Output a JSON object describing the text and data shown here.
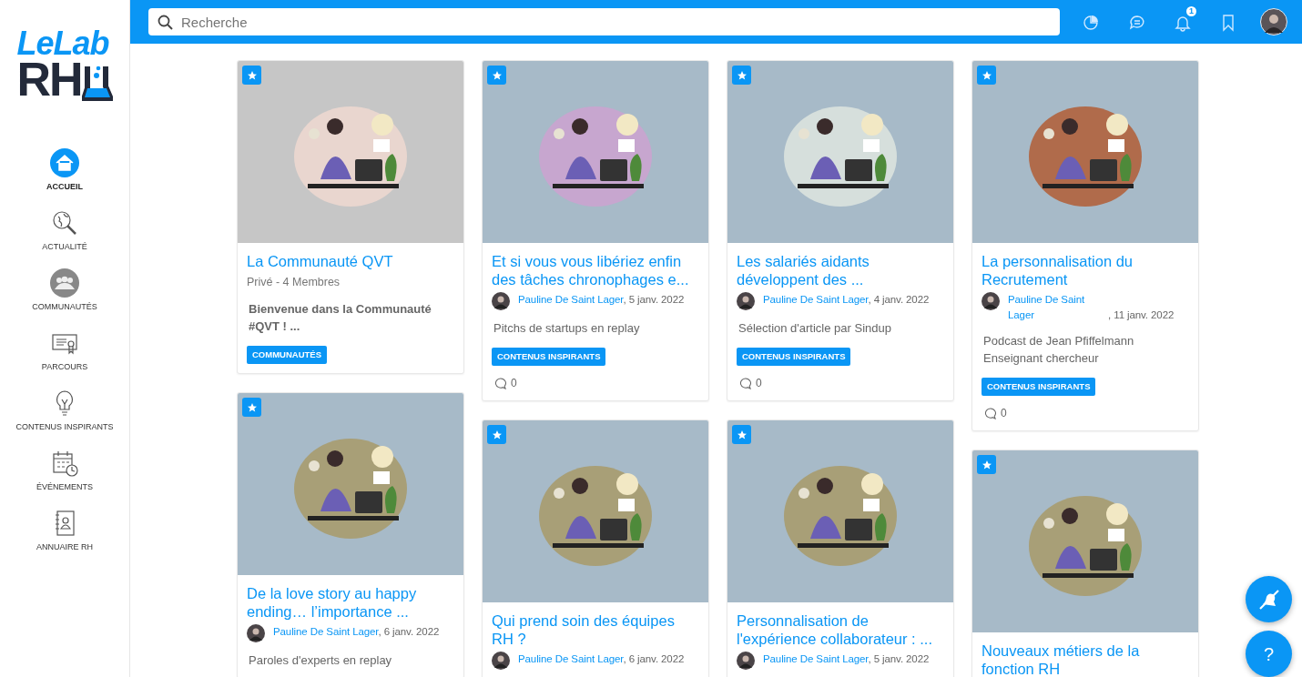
{
  "logo": {
    "top": "LeLab",
    "bottom": "RH"
  },
  "sidebar": {
    "items": [
      {
        "label": "ACCUEIL",
        "selected": true
      },
      {
        "label": "ACTUALITÉ",
        "selected": false
      },
      {
        "label": "COMMUNAUTÉS",
        "selected": false
      },
      {
        "label": "PARCOURS",
        "selected": false
      },
      {
        "label": "CONTENUS INSPIRANTS",
        "selected": false
      },
      {
        "label": "ÉVÉNEMENTS",
        "selected": false
      },
      {
        "label": "ANNUAIRE RH",
        "selected": false
      }
    ]
  },
  "topbar": {
    "search": {
      "placeholder": "Recherche"
    },
    "notifications": "1"
  },
  "columns": [
    [
      {
        "kind": "community",
        "title": "La Communauté QVT",
        "meta": "Privé - 4 Membres",
        "excerpt": "Bienvenue dans la Communauté #QVT ! ...",
        "tag": "COMMUNAUTÉS",
        "favorite": true
      },
      {
        "kind": "article",
        "title": "De la love story au happy ending… l’importance ...",
        "author": "Pauline De Saint Lager",
        "date": ", 6 janv. 2022",
        "excerpt": "Paroles d'experts en replay",
        "favorite": true
      }
    ],
    [
      {
        "kind": "article",
        "title": "Et si vous vous libériez enfin des tâches chronophages e...",
        "author": "Pauline De Saint Lager",
        "date": ", 5 janv. 2022",
        "excerpt": "Pitchs de startups en replay",
        "tag": "CONTENUS INSPIRANTS",
        "comments": "0",
        "favorite": true
      },
      {
        "kind": "article",
        "title": "Qui prend soin des équipes RH ?",
        "author": "Pauline De Saint Lager",
        "date": ", 6 janv. 2022",
        "favorite": true
      }
    ],
    [
      {
        "kind": "article",
        "title": "Les salariés aidants développent des ...",
        "author": "Pauline De Saint Lager",
        "date": ", 4 janv. 2022",
        "excerpt": "Sélection d'article par Sindup",
        "tag": "CONTENUS INSPIRANTS",
        "comments": "0",
        "favorite": true
      },
      {
        "kind": "article",
        "title": "Personnalisation de l'expérience collaborateur : ...",
        "author": "Pauline De Saint Lager",
        "date": ", 5 janv. 2022",
        "favorite": true
      }
    ],
    [
      {
        "kind": "article",
        "title": "La personnalisation du Recrutement",
        "author": "Pauline De Saint Lager",
        "date": ", 11 janv. 2022",
        "excerpt": "Podcast de Jean Pfiffelmann Enseignant chercheur",
        "tag": "CONTENUS INSPIRANTS",
        "comments": "0",
        "favorite": true
      },
      {
        "kind": "title_only",
        "title": "Nouveaux métiers de la fonction RH",
        "favorite": true
      }
    ]
  ],
  "help_button": "?"
}
